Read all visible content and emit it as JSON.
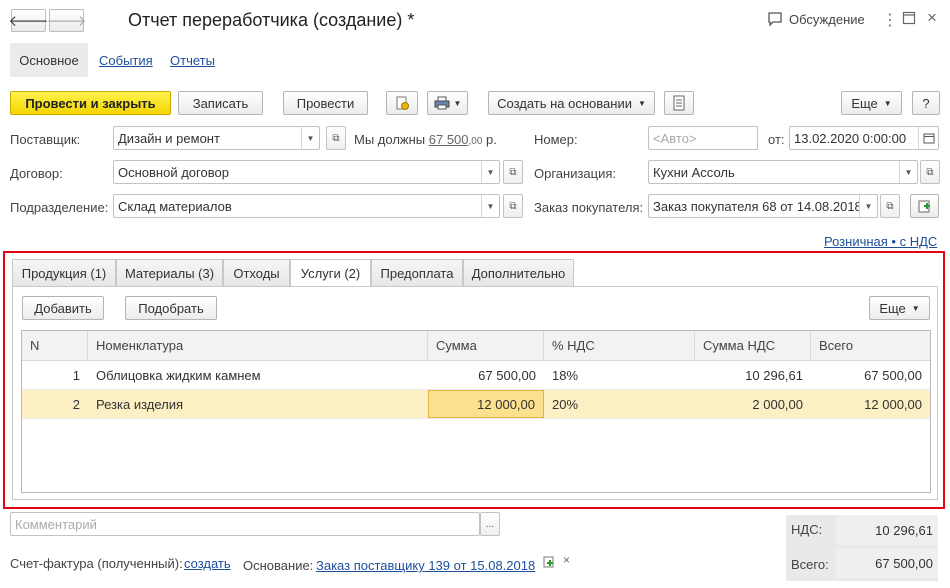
{
  "header": {
    "title": "Отчет переработчика (создание) *",
    "discussion": "Обсуждение"
  },
  "nav_tabs": [
    "Основное",
    "События",
    "Отчеты"
  ],
  "toolbar": {
    "post_close": "Провести и закрыть",
    "save": "Записать",
    "post": "Провести",
    "create_based": "Создать на основании",
    "more": "Еще",
    "help": "?"
  },
  "form": {
    "supplier_label": "Поставщик:",
    "supplier_value": "Дизайн и ремонт",
    "debt_text": "Мы должны",
    "debt_amount": "67 500",
    "debt_cents": ",00",
    "debt_currency": "р.",
    "number_label": "Номер:",
    "number_placeholder": "<Авто>",
    "date_from": "от:",
    "date_value": "13.02.2020  0:00:00",
    "contract_label": "Договор:",
    "contract_value": "Основной договор",
    "org_label": "Организация:",
    "org_value": "Кухни Ассоль",
    "division_label": "Подразделение:",
    "division_value": "Склад материалов",
    "order_label": "Заказ покупателя:",
    "order_value": "Заказ покупателя 68 от 14.08.2018",
    "price_link": "Розничная • с НДС"
  },
  "tabs": [
    "Продукция (1)",
    "Материалы (3)",
    "Отходы",
    "Услуги (2)",
    "Предоплата",
    "Дополнительно"
  ],
  "table_toolbar": {
    "add": "Добавить",
    "pick": "Подобрать",
    "more": "Еще"
  },
  "table": {
    "columns": [
      "N",
      "Номенклатура",
      "Сумма",
      "% НДС",
      "Сумма НДС",
      "Всего"
    ],
    "rows": [
      [
        "1",
        "Облицовка жидким камнем",
        "67 500,00",
        "18%",
        "10 296,61",
        "67 500,00"
      ],
      [
        "2",
        "Резка изделия",
        "12 000,00",
        "20%",
        "2 000,00",
        "12 000,00"
      ]
    ]
  },
  "footer": {
    "comment_placeholder": "Комментарий",
    "invoice_label": "Счет-фактура (полученный):",
    "invoice_link": "создать",
    "basis_label": "Основание:",
    "basis_link": "Заказ поставщику 139 от 15.08.2018",
    "vat_label": "НДС:",
    "vat_value": "10 296,61",
    "total_label": "Всего:",
    "total_value": "67 500,00"
  },
  "colors": {
    "highlight_border": "#e30613",
    "primary_button": "#f4d500",
    "link": "#1c4f9c",
    "selected_row": "#fbefc3"
  }
}
